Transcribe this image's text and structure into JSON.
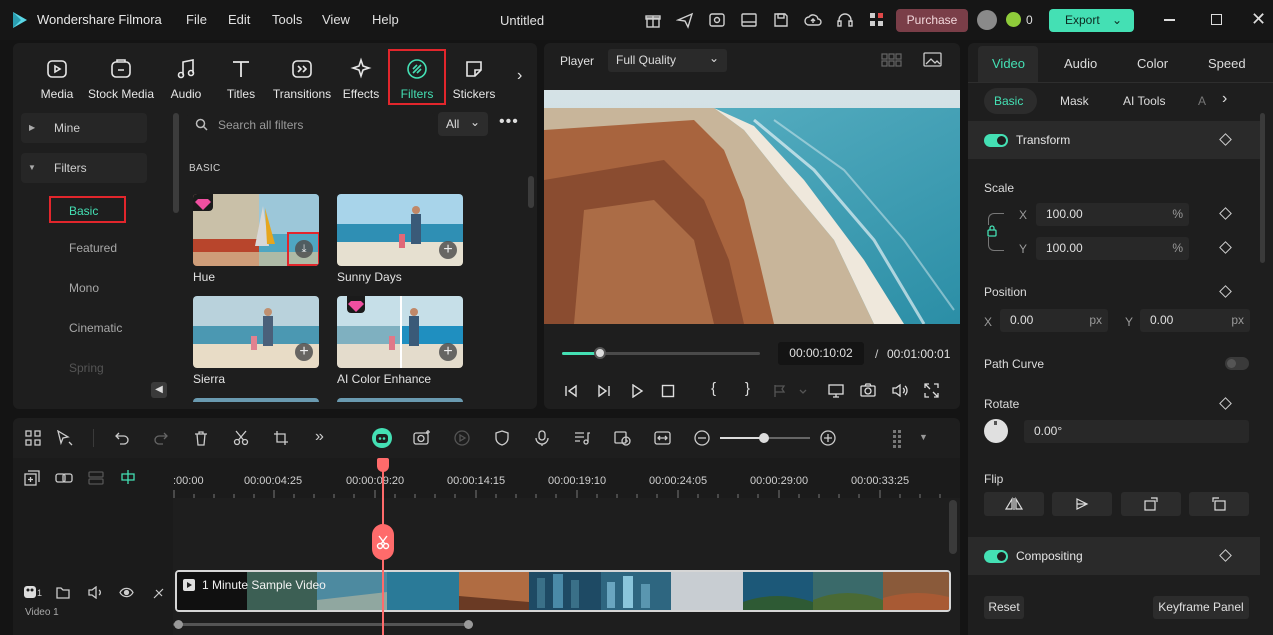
{
  "app": {
    "name": "Wondershare Filmora",
    "document_title": "Untitled"
  },
  "menu": [
    "File",
    "Edit",
    "Tools",
    "View",
    "Help"
  ],
  "topbar": {
    "purchase": "Purchase",
    "credits": "0",
    "export": "Export"
  },
  "library": {
    "tabs": [
      "Media",
      "Stock Media",
      "Audio",
      "Titles",
      "Transitions",
      "Effects",
      "Filters",
      "Stickers"
    ],
    "active_tab": "Filters",
    "sidebar": {
      "mine": "Mine",
      "filters": "Filters",
      "subitems": [
        "Basic",
        "Featured",
        "Mono",
        "Cinematic",
        "Spring"
      ],
      "active_sub": "Basic"
    },
    "search_placeholder": "Search all filters",
    "filter_dropdown": "All",
    "section_title": "BASIC",
    "items": [
      "Hue",
      "Sunny Days",
      "Sierra",
      "AI Color Enhance"
    ]
  },
  "player": {
    "label": "Player",
    "quality": "Full Quality",
    "current_time": "00:00:10:02",
    "separator": "/",
    "total_time": "00:01:00:01",
    "progress": 0.19
  },
  "properties": {
    "tabs": [
      "Video",
      "Audio",
      "Color",
      "Speed"
    ],
    "active_tab": "Video",
    "subtabs": [
      "Basic",
      "Mask",
      "AI Tools",
      "A"
    ],
    "transform": "Transform",
    "scale": {
      "label": "Scale",
      "x_label": "X",
      "x": "100.00",
      "y_label": "Y",
      "y": "100.00",
      "unit": "%"
    },
    "position": {
      "label": "Position",
      "x_label": "X",
      "x": "0.00",
      "y_label": "Y",
      "y": "0.00",
      "unit": "px"
    },
    "path_curve": "Path Curve",
    "rotate": {
      "label": "Rotate",
      "value": "0.00°"
    },
    "flip": "Flip",
    "compositing": "Compositing",
    "reset": "Reset",
    "keyframe_panel": "Keyframe Panel"
  },
  "timeline": {
    "ruler": [
      ":00:00",
      "00:00:04:25",
      "00:00:09:20",
      "00:00:14:15",
      "00:00:19:10",
      "00:00:24:05",
      "00:00:29:00",
      "00:00:33:25"
    ],
    "clip_name": "1 Minute Sample Video",
    "track_label": "Video 1",
    "track_number": "1"
  },
  "colors": {
    "accent": "#44e0b4",
    "highlight_box": "#e2262c",
    "playhead": "#ff6b6b",
    "purchase": "#7a3e48"
  }
}
